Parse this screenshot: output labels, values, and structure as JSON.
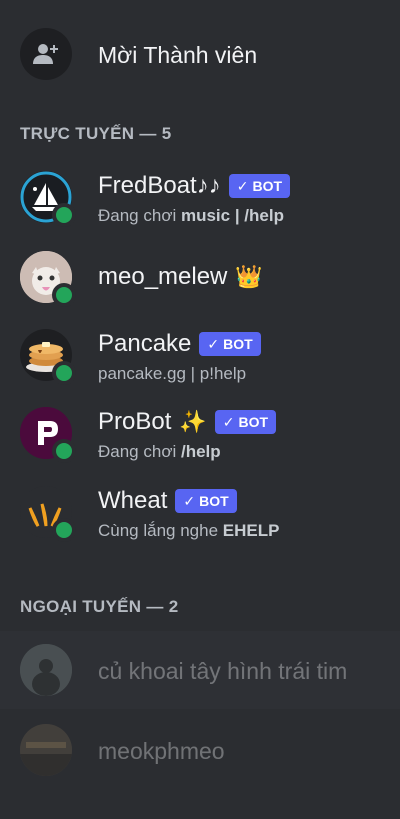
{
  "invite": {
    "label": "Mời Thành viên",
    "icon": "add-user-icon"
  },
  "online": {
    "header": "TRỰC TUYẾN — 5",
    "members": [
      {
        "name": "FredBoat♪♪",
        "badge": "BOT",
        "activity_prefix": "Đang chơi ",
        "activity_bold": "music | /help",
        "avatar": "fredboat-avatar"
      },
      {
        "name": "meo_melew",
        "crown": "👑",
        "avatar": "cat-avatar"
      },
      {
        "name": "Pancake",
        "badge": "BOT",
        "activity": "pancake.gg | p!help",
        "avatar": "pancake-avatar"
      },
      {
        "name": "ProBot",
        "sparkle": "✨",
        "badge": "BOT",
        "activity_prefix": "Đang chơi ",
        "activity_bold": "/help",
        "avatar": "probot-avatar"
      },
      {
        "name": "Wheat",
        "badge": "BOT",
        "activity_prefix": "Cùng lắng nghe ",
        "activity_bold": "EHELP",
        "avatar": "wheat-avatar"
      }
    ]
  },
  "offline": {
    "header": "NGOẠI TUYẾN — 2",
    "members": [
      {
        "name": "củ khoai tây hình trái tim"
      },
      {
        "name": "meokphmeo"
      }
    ]
  },
  "colors": {
    "background": "#2b2d31",
    "online": "#23a55a",
    "bot_badge": "#5865f2"
  }
}
